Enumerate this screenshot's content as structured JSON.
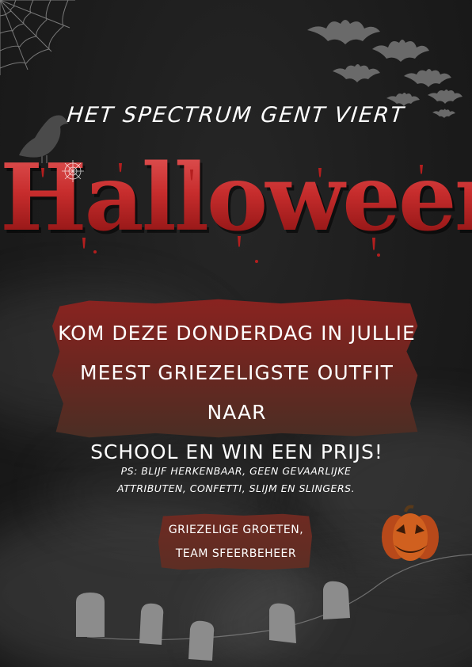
{
  "subtitle": "HET SPECTRUM GENT VIERT",
  "headline": "Halloween",
  "banner": {
    "line1": "KOM DEZE DONDERDAG IN JULLIE",
    "line2": "MEEST GRIEZELIGSTE OUTFIT NAAR",
    "line3": "SCHOOL EN WIN EEN PRIJS!"
  },
  "ps": {
    "line1": "PS: BLIJF HERKENBAAR, GEEN GEVAARLIJKE",
    "line2": "ATTRIBUTEN, CONFETTI, SLIJM EN SLINGERS."
  },
  "signoff": {
    "line1": "GRIEZELIGE GROETEN,",
    "line2": "TEAM SFEERBEHEER"
  },
  "icons": [
    "spiderweb-icon",
    "bats-icon",
    "crow-icon",
    "pumpkin-icon",
    "tombstone-icon"
  ],
  "colors": {
    "background": "#1b1b1b",
    "headline_red": "#c72d2d",
    "banner_top": "#8a2320",
    "banner_bottom": "#4a2e24",
    "text": "#ffffff",
    "pumpkin": "#c4531c"
  }
}
